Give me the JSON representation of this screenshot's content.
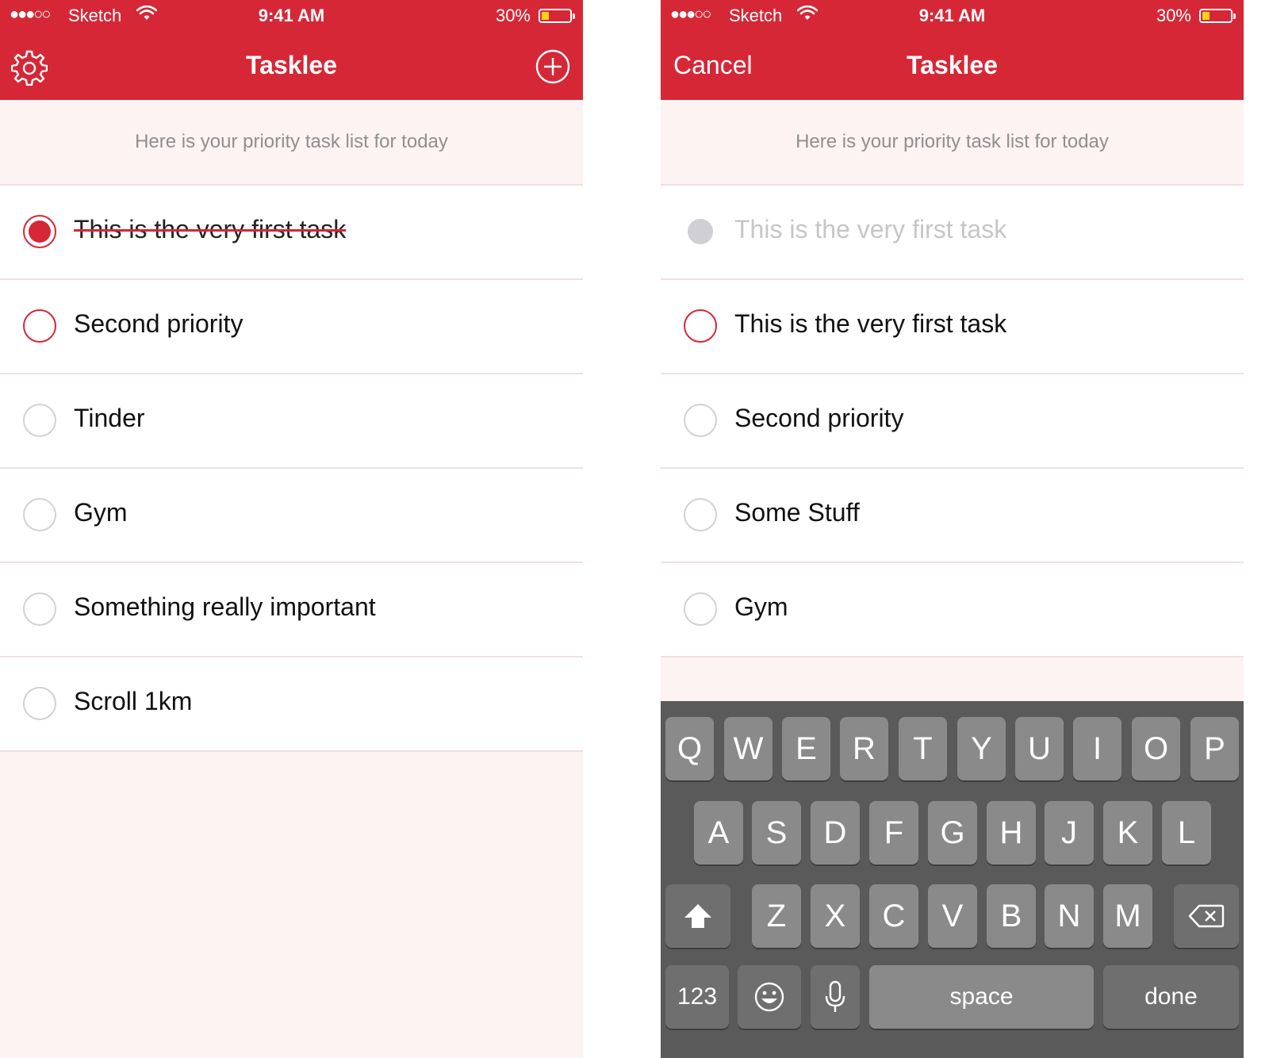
{
  "status_bar": {
    "signal": "●●●○○",
    "carrier": "Sketch",
    "time": "9:41 AM",
    "battery": "30%"
  },
  "left": {
    "title": "Tasklee",
    "subtitle": "Here is your priority task list for today",
    "tasks": [
      {
        "label": "This is the very first task",
        "state": "done"
      },
      {
        "label": "Second priority",
        "state": "active"
      },
      {
        "label": "Tinder",
        "state": "open"
      },
      {
        "label": "Gym",
        "state": "open"
      },
      {
        "label": "Something really important",
        "state": "open"
      },
      {
        "label": "Scroll 1km",
        "state": "open"
      }
    ]
  },
  "right": {
    "cancel_label": "Cancel",
    "title": "Tasklee",
    "subtitle": "Here is your priority task list for today",
    "tasks": [
      {
        "label": "This is the very first task",
        "state": "ghost"
      },
      {
        "label": "This is the very first task",
        "state": "active"
      },
      {
        "label": "Second priority",
        "state": "open"
      },
      {
        "label": "Some Stuff",
        "state": "open"
      },
      {
        "label": "Gym",
        "state": "open"
      }
    ]
  },
  "keyboard": {
    "row1": [
      "Q",
      "W",
      "E",
      "R",
      "T",
      "Y",
      "U",
      "I",
      "O",
      "P"
    ],
    "row2": [
      "A",
      "S",
      "D",
      "F",
      "G",
      "H",
      "J",
      "K",
      "L"
    ],
    "row3": [
      "Z",
      "X",
      "C",
      "V",
      "B",
      "N",
      "M"
    ],
    "numbers_label": "123",
    "space_label": "space",
    "done_label": "done"
  },
  "colors": {
    "brand_red": "#d62736",
    "background_tint": "#fdf3f3",
    "keyboard": "#5a5a5a"
  },
  "icons": [
    "signal-dots-icon",
    "wifi-icon",
    "battery-icon",
    "gear-icon",
    "plus-circle-icon",
    "shift-icon",
    "backspace-icon",
    "emoji-icon",
    "microphone-icon"
  ]
}
